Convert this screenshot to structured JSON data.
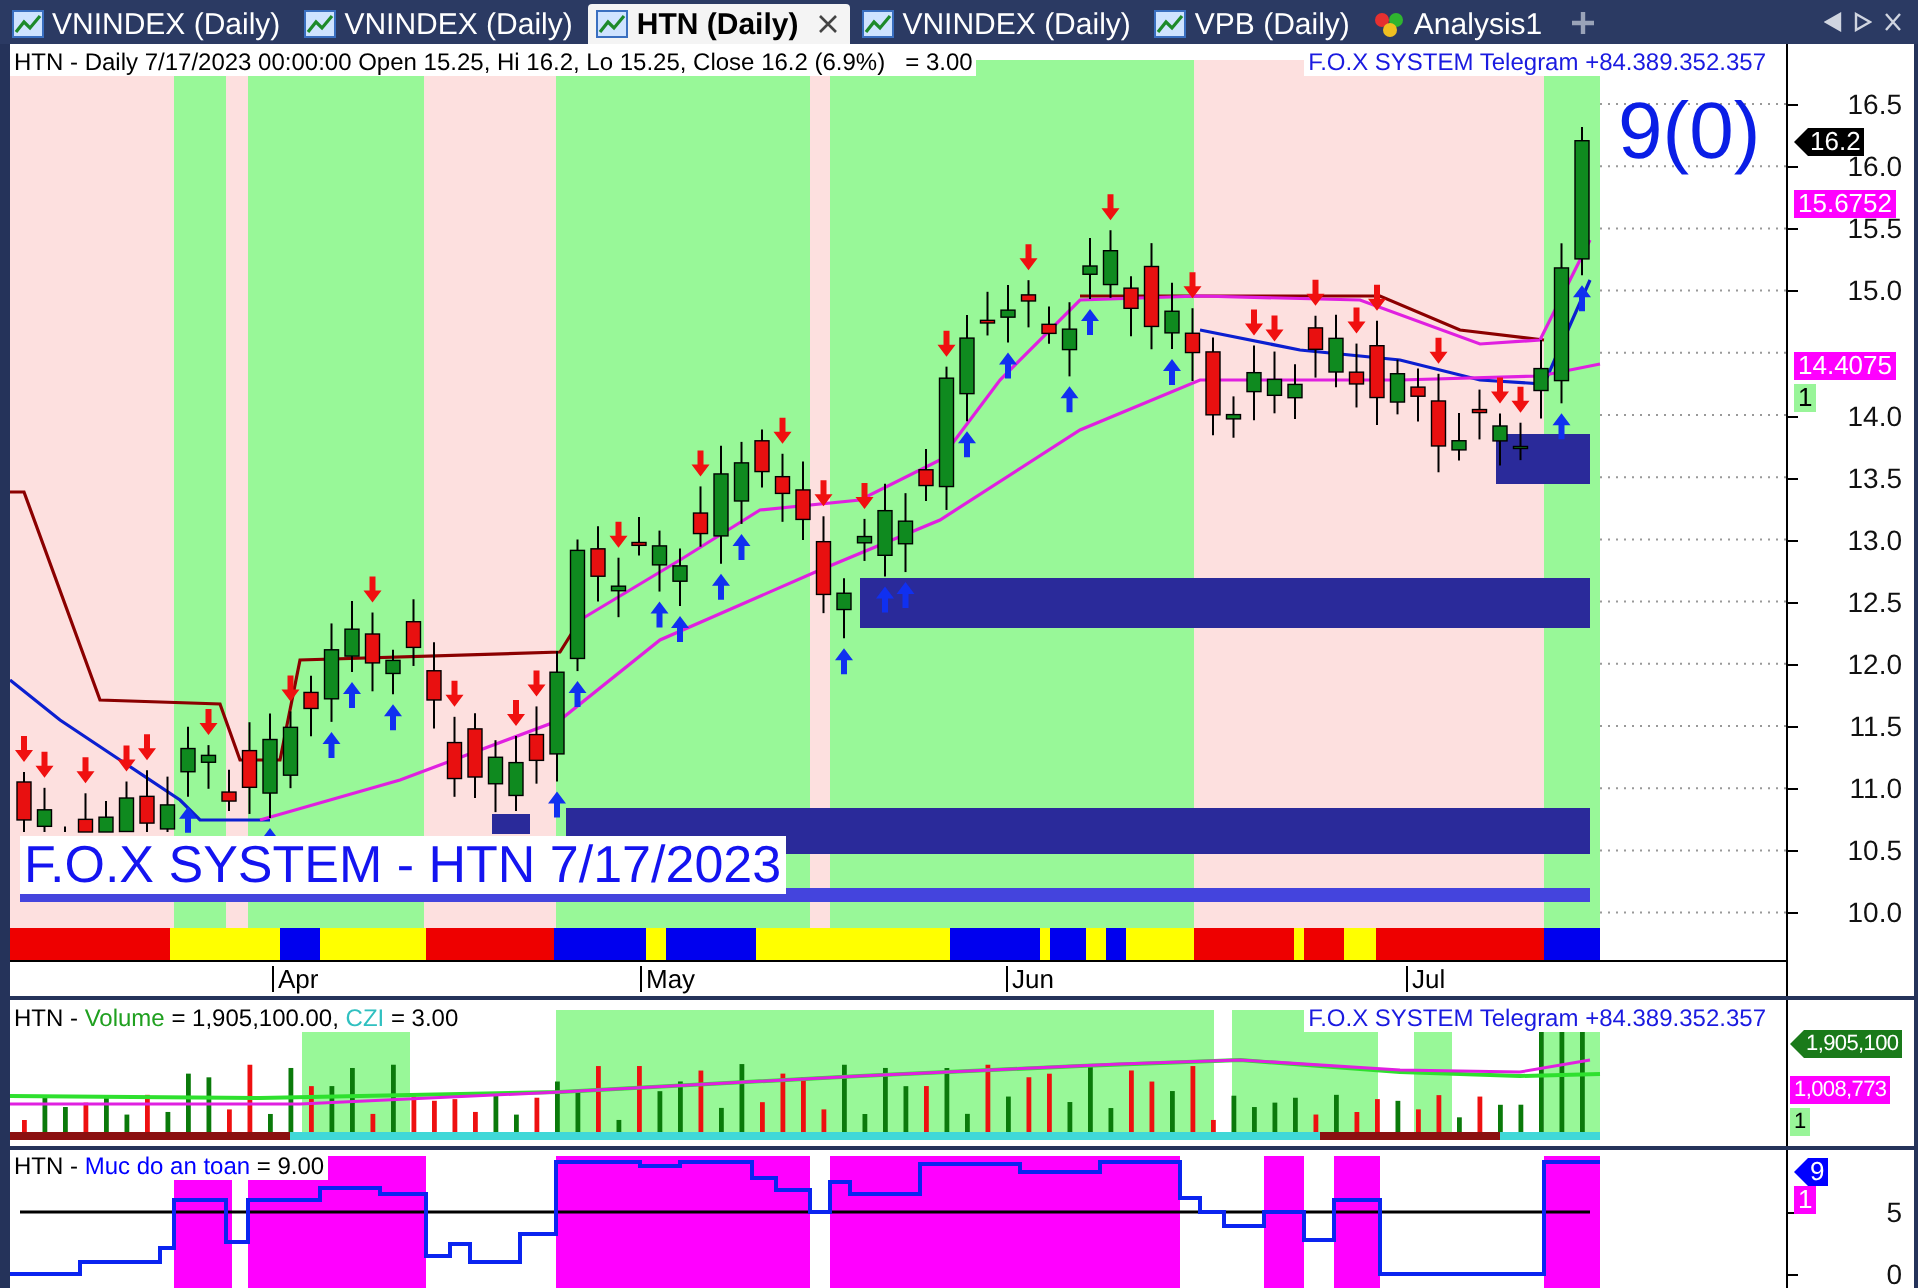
{
  "tabs": [
    {
      "label": "VNINDEX (Daily)",
      "selected": false,
      "kind": "chart"
    },
    {
      "label": "VNINDEX (Daily)",
      "selected": false,
      "kind": "chart"
    },
    {
      "label": "HTN (Daily)",
      "selected": true,
      "kind": "chart"
    },
    {
      "label": "VNINDEX (Daily)",
      "selected": false,
      "kind": "chart"
    },
    {
      "label": "VPB (Daily)",
      "selected": false,
      "kind": "chart"
    },
    {
      "label": "Analysis1",
      "selected": false,
      "kind": "analysis"
    }
  ],
  "price_panel": {
    "legend": "HTN - Daily 7/17/2023 00:00:00 Open 15.25, Hi 16.2, Lo 15.25, Close 16.2 (6.9%)   = 3.00",
    "telegram": "F.O.X SYSTEM Telegram +84.389.352.357",
    "signal": "9(0)",
    "chart_title": "F.O.X SYSTEM - HTN 7/17/2023",
    "y_ticks": [
      "16.5",
      "16.0",
      "15.5",
      "15.0",
      "14.0",
      "13.5",
      "13.0",
      "12.5",
      "12.0",
      "11.5",
      "11.0",
      "10.5",
      "10.0"
    ],
    "x_labels": [
      "Apr",
      "May",
      "Jun",
      "Jul"
    ],
    "value_labels": [
      {
        "text": "16.2",
        "color": "#000000",
        "kind": "pointer"
      },
      {
        "text": "15.6752",
        "color": "#ff00ff",
        "kind": "box"
      },
      {
        "text": "14.4075",
        "color": "#ff00ff",
        "kind": "box"
      },
      {
        "text": "1",
        "color": "#99f599",
        "kind": "box"
      }
    ]
  },
  "volume_panel": {
    "legend": [
      {
        "text": "HTN - ",
        "color": "#000000"
      },
      {
        "text": "Volume",
        "color": "#20a020"
      },
      {
        "text": " = 1,905,100.00, ",
        "color": "#000000"
      },
      {
        "text": "CZI",
        "color": "#30c0c0"
      },
      {
        "text": " = 3.00",
        "color": "#000000"
      }
    ],
    "telegram": "F.O.X SYSTEM Telegram +84.389.352.357",
    "value_labels": [
      {
        "text": "1,905,100",
        "color": "#1a7a1a",
        "kind": "pointer"
      },
      {
        "text": "1,008,773",
        "color": "#ff00ff",
        "kind": "box"
      },
      {
        "text": "1",
        "color": "#99f599",
        "kind": "box"
      }
    ]
  },
  "safety_panel": {
    "legend": [
      {
        "text": "HTN - ",
        "color": "#000000"
      },
      {
        "text": "Muc do an toan",
        "color": "#0000ff"
      },
      {
        "text": " = 9.00",
        "color": "#000000"
      }
    ],
    "y_ticks": [
      "5",
      "0"
    ],
    "value_labels": [
      {
        "text": "9",
        "color": "#0000ff",
        "kind": "pointer"
      },
      {
        "text": "1",
        "color": "#ff00ff",
        "kind": "box"
      }
    ]
  }
}
